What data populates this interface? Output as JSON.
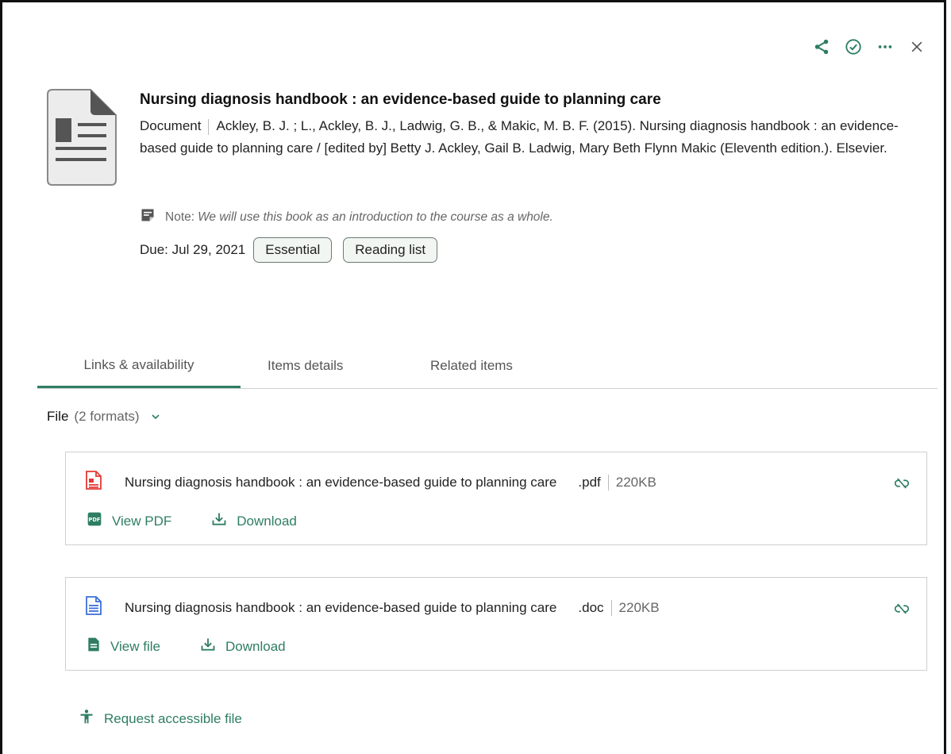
{
  "toolbar": {
    "icons": [
      "share-icon",
      "check-circle-icon",
      "more-icon",
      "close-icon"
    ],
    "accent": "#2e7d64"
  },
  "item": {
    "title": "Nursing diagnosis handbook : an evidence-based guide to planning care",
    "type": "Document",
    "citation": "Ackley, B. J. ; L., Ackley, B. J., Ladwig, G. B., & Makic, M. B. F. (2015). Nursing diagnosis handbook : an evidence-based guide to planning care / [edited by] Betty J. Ackley, Gail B. Ladwig, Mary Beth Flynn Makic (Eleventh edition.). Elsevier.",
    "note_label": "Note:",
    "note_text": "We will use this book as an introduction to the course as a whole.",
    "due": "Due: Jul 29, 2021",
    "tags": [
      "Essential",
      "Reading list"
    ]
  },
  "tabs": [
    {
      "label": "Links & availability",
      "active": true
    },
    {
      "label": "Items details",
      "active": false
    },
    {
      "label": "Related items",
      "active": false
    }
  ],
  "files": {
    "label": "File",
    "count": "(2 formats)",
    "items": [
      {
        "name": "Nursing diagnosis handbook : an evidence-based guide to planning care",
        "ext": ".pdf",
        "size": "220KB",
        "view_label": "View PDF",
        "download_label": "Download",
        "icon": "pdf-file-icon",
        "color": "#e53935"
      },
      {
        "name": "Nursing diagnosis handbook : an evidence-based guide to planning care",
        "ext": ".doc",
        "size": "220KB",
        "view_label": "View file",
        "download_label": "Download",
        "icon": "doc-file-icon",
        "color": "#3b6fd8"
      }
    ]
  },
  "accessible": {
    "label": "Request accessible file"
  }
}
